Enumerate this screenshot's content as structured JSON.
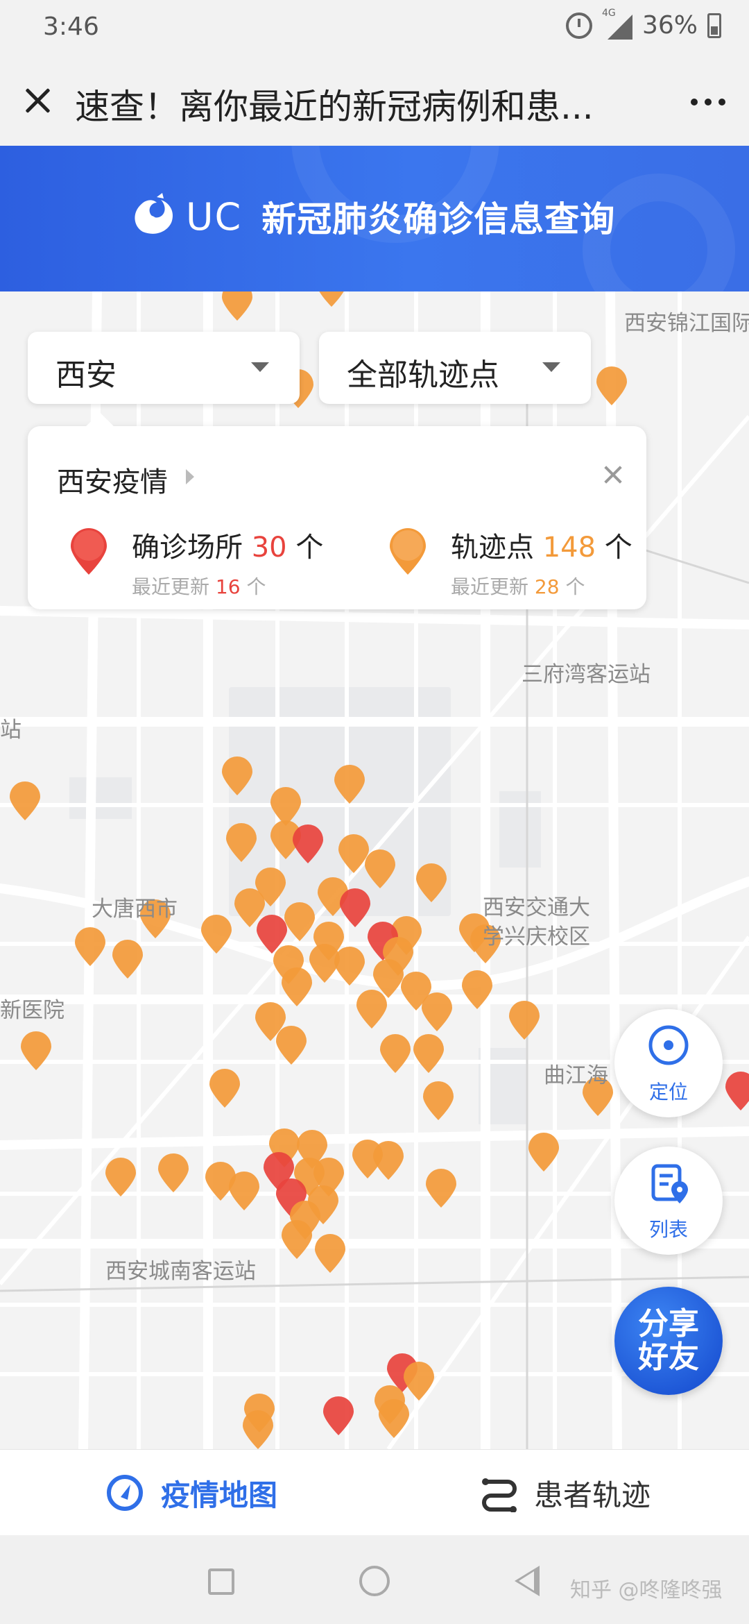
{
  "status_bar": {
    "time": "3:46",
    "network": "4G",
    "battery": "36%"
  },
  "title_bar": {
    "title": "速查！离你最近的新冠病例和患..."
  },
  "banner": {
    "brand": "UC",
    "title": "新冠肺炎确诊信息查询"
  },
  "filters": {
    "city": "西安",
    "trajectory": "全部轨迹点"
  },
  "info_card": {
    "title": "西安疫情",
    "confirmed": {
      "label": "确诊场所",
      "count": "30",
      "unit": "个",
      "update_label": "最近更新",
      "update_count": "16",
      "update_unit": "个"
    },
    "trajectory": {
      "label": "轨迹点",
      "count": "148",
      "unit": "个",
      "update_label": "最近更新",
      "update_count": "28",
      "update_unit": "个"
    }
  },
  "map_labels": {
    "jinjiang": "西安锦江国际",
    "sanfu": "三府湾客运站",
    "zhan": "站",
    "datang": "大唐西市",
    "jiaoda_1": "西安交通大",
    "jiaoda_2": "学兴庆校区",
    "yiyuan": "新医院",
    "qujiang": "曲江海",
    "chengnan": "西安城南客运站"
  },
  "fabs": {
    "locate": "定位",
    "list": "列表",
    "share": "分享好友"
  },
  "tabs": {
    "map": "疫情地图",
    "trajectory": "患者轨迹"
  },
  "watermark": "知乎 @咚隆咚强",
  "colors": {
    "accent": "#2f6fe8",
    "confirmed": "#e8433d",
    "trajectory": "#f39a3a",
    "banner": "#3a6fe8"
  },
  "icons": {
    "close": "close-icon",
    "more": "more-icon",
    "locate": "locate-icon",
    "list": "list-icon",
    "map_tab": "compass-icon",
    "trajectory_tab": "route-icon"
  }
}
